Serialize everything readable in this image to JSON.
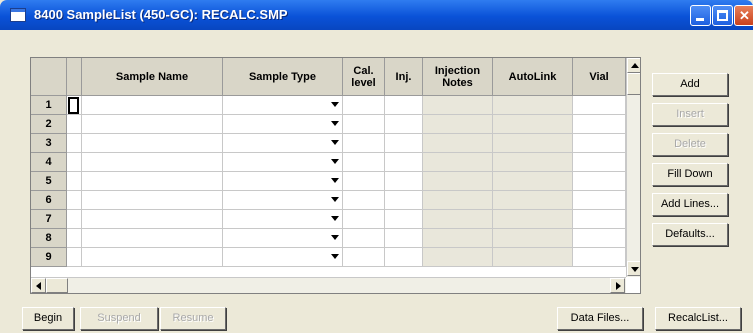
{
  "window": {
    "title": "8400 SampleList (450-GC): RECALC.SMP"
  },
  "colors": {
    "title_bar": "#0a52d8",
    "face": "#ece9d8",
    "header": "#d9d6c8",
    "disabled_text": "#a8a8a8"
  },
  "icons": {
    "app": "window-icon",
    "minimize": "minimize-icon",
    "maximize": "maximize-icon",
    "close": "close-icon",
    "dropdown": "chevron-down-icon"
  },
  "table": {
    "headers": {
      "sample_name": "Sample Name",
      "sample_type": "Sample Type",
      "cal_level": "Cal. level",
      "inj": "Inj.",
      "injection_notes": "Injection Notes",
      "autolink": "AutoLink",
      "vial": "Vial"
    },
    "rows": [
      "1",
      "2",
      "3",
      "4",
      "5",
      "6",
      "7",
      "8",
      "9"
    ]
  },
  "side_buttons": {
    "add": "Add",
    "insert": "Insert",
    "delete": "Delete",
    "fill_down": "Fill Down",
    "add_lines": "Add Lines...",
    "defaults": "Defaults..."
  },
  "bottom_buttons": {
    "begin": "Begin",
    "suspend": "Suspend",
    "resume": "Resume",
    "data_files": "Data Files...",
    "recalc_list": "RecalcList..."
  }
}
